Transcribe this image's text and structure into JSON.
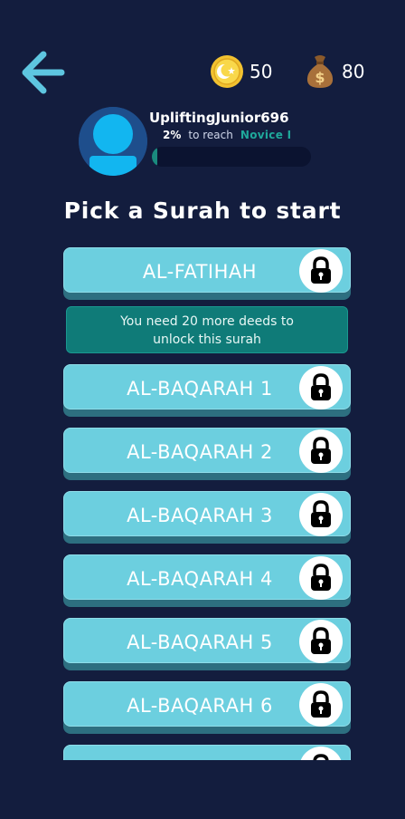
{
  "header": {
    "back_icon": "arrow-left-icon",
    "coins": {
      "icon": "crescent-coin-icon",
      "value": "50"
    },
    "money": {
      "icon": "money-bag-icon",
      "value": "80"
    }
  },
  "profile": {
    "username": "UpliftingJunior696",
    "percent": "2%",
    "reach_text": "to reach",
    "next_rank": "Novice I",
    "progress_fraction": 0.02
  },
  "headline": "Pick a Surah to start",
  "notice": {
    "line1": "You need 20 more deeds to",
    "line2": "unlock this surah"
  },
  "surahs": [
    {
      "label": "AL-FATIHAH",
      "locked": true
    },
    {
      "label": "AL-BAQARAH 1",
      "locked": true
    },
    {
      "label": "AL-BAQARAH 2",
      "locked": true
    },
    {
      "label": "AL-BAQARAH 3",
      "locked": true
    },
    {
      "label": "AL-BAQARAH 4",
      "locked": true
    },
    {
      "label": "AL-BAQARAH 5",
      "locked": true
    },
    {
      "label": "AL-BAQARAH 6",
      "locked": true
    },
    {
      "label": "",
      "locked": true
    }
  ],
  "colors": {
    "background": "#131d3e",
    "button_face": "#6ccfdf",
    "notice": "#0f7b78",
    "rank": "#1fa89b"
  }
}
